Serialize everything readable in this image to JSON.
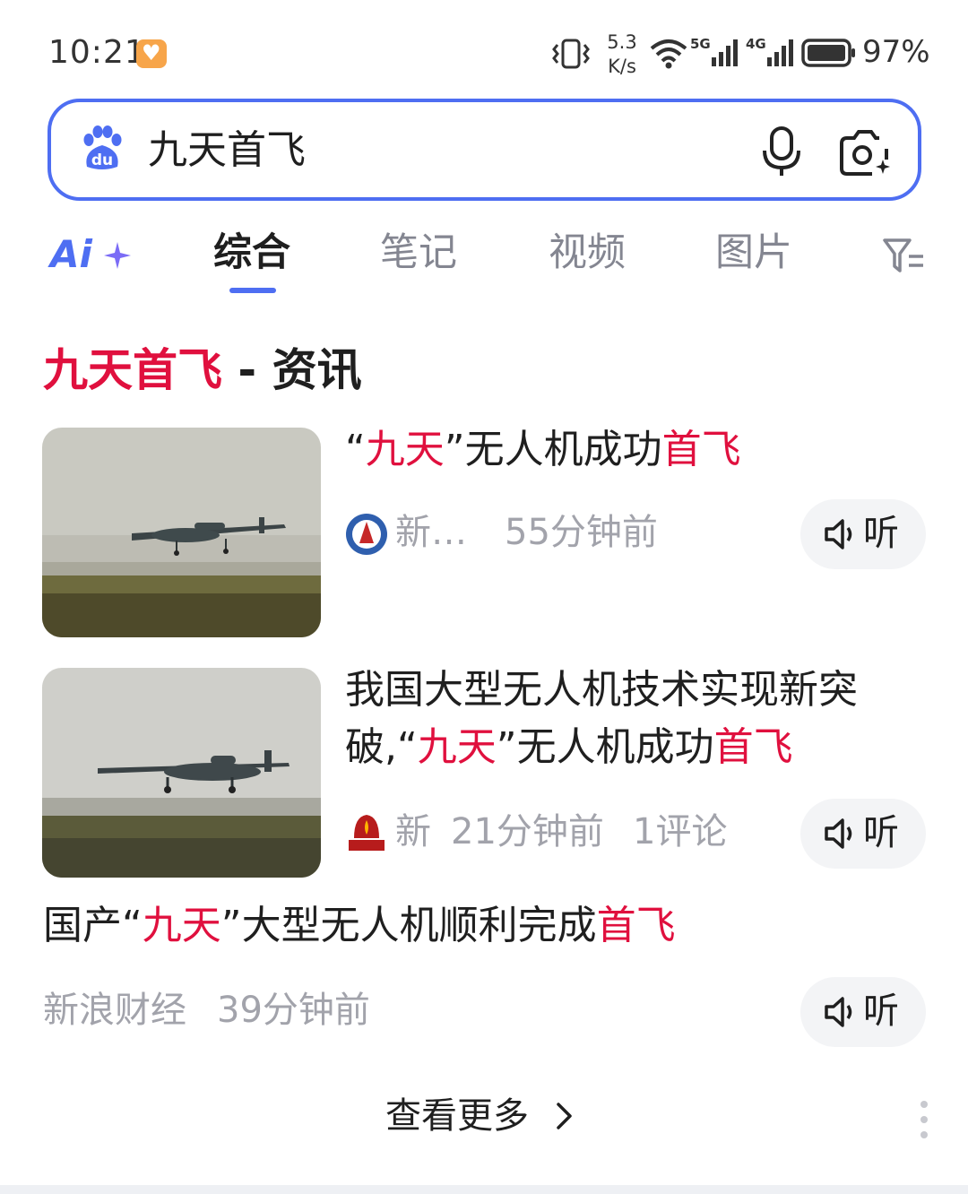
{
  "status_bar": {
    "time": "10:21",
    "net_speed_value": "5.3",
    "net_speed_unit": "K/s",
    "network_1": "5G",
    "network_2": "4G",
    "battery": "97%"
  },
  "search": {
    "query": "九天首飞",
    "logo_text": "du",
    "accent_color": "#4e6ef2"
  },
  "tabs": {
    "ai_label": "Ai",
    "items": [
      "综合",
      "笔记",
      "视频",
      "图片"
    ],
    "active_index": 0
  },
  "news_section": {
    "title_keyword": "九天首飞",
    "title_suffix": " - 资讯",
    "highlight_color": "#e0103e",
    "items": [
      {
        "title_parts": [
          "“",
          "九天",
          "”无人机成功",
          "首飞"
        ],
        "source": "新…",
        "time": "55分钟前",
        "comments": "",
        "listen_label": "听"
      },
      {
        "title_line1": "我国大型无人机技术实现新突",
        "title_parts": [
          "破,“",
          "九天",
          "”无人机成功",
          "首飞"
        ],
        "source": "新",
        "time": "21分钟前",
        "comments": "1评论",
        "listen_label": "听"
      },
      {
        "title_parts": [
          "国产“",
          "九天",
          "”大型无人机顺利完成",
          "首飞"
        ],
        "source": "新浪财经",
        "time": "39分钟前",
        "comments": "",
        "listen_label": "听"
      }
    ],
    "more_label": "查看更多"
  }
}
